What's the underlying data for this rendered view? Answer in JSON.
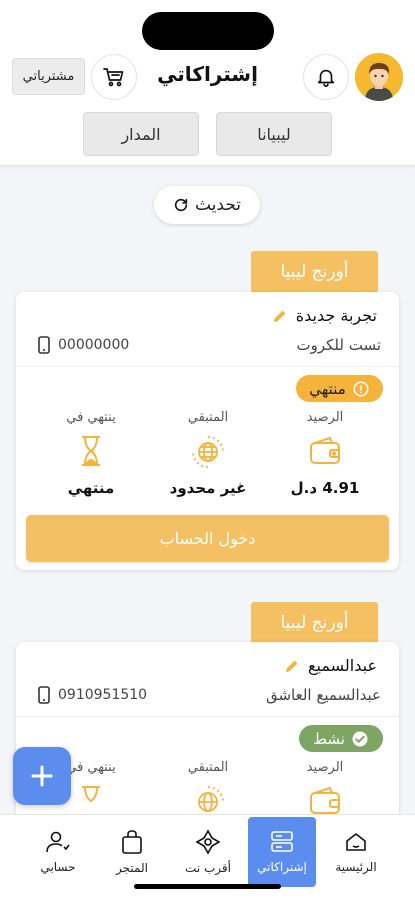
{
  "header": {
    "title": "إشتراكاتي",
    "purchases_label": "مشترياتي",
    "providers": [
      "ليبيانا",
      "المدار"
    ]
  },
  "refresh_label": "تحديث",
  "subscriptions": [
    {
      "provider": "أورنج ليبيا",
      "name": "تجربة جديدة",
      "subtitle": "تست للكروت",
      "phone": "00000000",
      "status": "منتهي",
      "balance_label": "الرصيد",
      "balance_value": "4.91 د.ل",
      "remaining_label": "المتبقي",
      "remaining_value": "غير محدود",
      "expires_label": "ينتهي في",
      "expires_value": "منتهي",
      "login_label": "دخول الحساب"
    },
    {
      "provider": "أورنج ليبيا",
      "name": "عبدالسميع",
      "subtitle": "عبدالسميع العاشق",
      "phone": "0910951510",
      "status": "نشط",
      "balance_label": "الرصيد",
      "remaining_label": "المتبقي",
      "expires_label": "ينتهي في"
    }
  ],
  "bottom_nav": [
    {
      "label": "الرئيسية",
      "icon": "home-icon"
    },
    {
      "label": "إشتراكاتي",
      "icon": "subscriptions-icon",
      "active": true
    },
    {
      "label": "أقرب نت",
      "icon": "nearby-icon"
    },
    {
      "label": "المتجر",
      "icon": "bag-icon"
    },
    {
      "label": "حسابي",
      "icon": "account-icon"
    }
  ],
  "colors": {
    "accent": "#f3c163",
    "primary": "#5b8def",
    "active_status": "#7ea564",
    "expired_status": "#f3b33d"
  }
}
